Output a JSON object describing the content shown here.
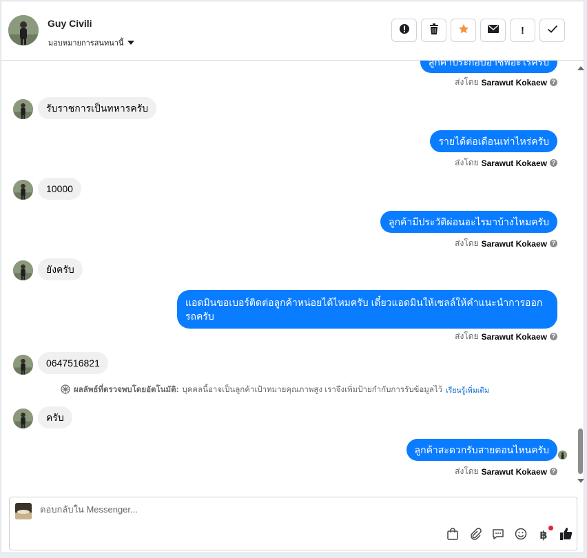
{
  "contact": {
    "name": "Guy Civili",
    "assign_label": "มอบหมายการสนทนานี้"
  },
  "actions": [
    {
      "icon": "report-icon",
      "label": ""
    },
    {
      "icon": "trash-icon",
      "label": ""
    },
    {
      "icon": "star-icon",
      "label": ""
    },
    {
      "icon": "envelope-icon",
      "label": ""
    },
    {
      "icon": "exclamation-icon",
      "label": "!"
    },
    {
      "icon": "check-icon",
      "label": ""
    }
  ],
  "colors": {
    "outgoing_bubble": "#0a7cff",
    "incoming_bubble": "#f0f0f0",
    "star": "#f7923a",
    "link": "#0064d1"
  },
  "messages": {
    "cut_top": "ลูกค้าประกอบอาชีพอะไรครับ",
    "sent_prefix": "ส่งโดย",
    "sender": "Sarawut Kokaew",
    "m1": "รับราชการเป็นทหารครับ",
    "m2": "รายได้ต่อเดือนเท่าไหร่ครับ",
    "m3": "10000",
    "m4": "ลูกค้ามีประวัติผ่อนอะไรมาบ้างไหมครับ",
    "m5": "ยังครับ",
    "m6": "แอดมินขอเบอร์ติดต่อลูกค้าหน่อยได้ไหมครับ เดี๋ยวแอดมินให้เซลล์ให้คำแนะนำการออกรถครับ",
    "m7": "0647516821",
    "m8": "ครับ",
    "m9": "ลูกค้าสะดวกรับสายตอนไหนครับ"
  },
  "ai_note": {
    "title": "ผลลัพธ์ที่ตรวจพบโดยอัตโนมัติ:",
    "text": "บุคคลนี้อาจเป็นลูกค้าเป้าหมายคุณภาพสูง เราจึงเพิ่มป้ายกำกับการรับข้อมูลไว้",
    "link": "เรียนรู้เพิ่มเติม"
  },
  "composer": {
    "placeholder": "ตอบกลับใน Messenger...",
    "tools": [
      "bag-icon",
      "paperclip-icon",
      "quick-reply-icon",
      "emoji-icon",
      "baht-icon",
      "thumbs-up-icon"
    ],
    "baht_symbol": "฿"
  }
}
